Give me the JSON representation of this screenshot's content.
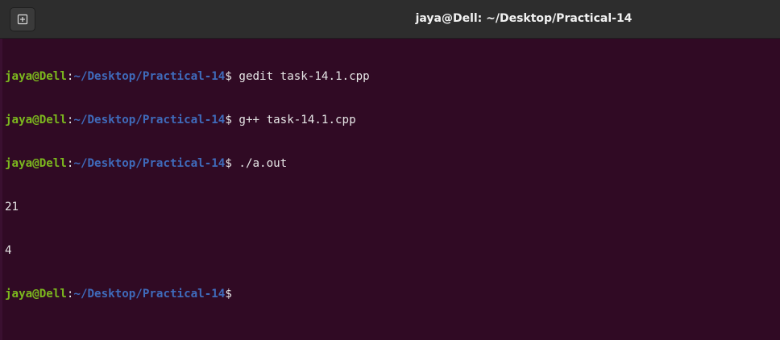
{
  "window": {
    "title": "jaya@Dell: ~/Desktop/Practical-14"
  },
  "titlebar": {
    "new_tab_icon": "new-tab-icon"
  },
  "terminal": {
    "lines": [
      {
        "type": "prompt",
        "user": "jaya@Dell",
        "sep": ":",
        "path": "~/Desktop/Practical-14",
        "dollar": "$",
        "command": " gedit task-14.1.cpp"
      },
      {
        "type": "prompt",
        "user": "jaya@Dell",
        "sep": ":",
        "path": "~/Desktop/Practical-14",
        "dollar": "$",
        "command": " g++ task-14.1.cpp"
      },
      {
        "type": "prompt",
        "user": "jaya@Dell",
        "sep": ":",
        "path": "~/Desktop/Practical-14",
        "dollar": "$",
        "command": " ./a.out"
      },
      {
        "type": "output",
        "text": "21"
      },
      {
        "type": "output",
        "text": "4"
      },
      {
        "type": "prompt",
        "user": "jaya@Dell",
        "sep": ":",
        "path": "~/Desktop/Practical-14",
        "dollar": "$",
        "command": ""
      }
    ]
  },
  "colors": {
    "background": "#300a24",
    "user": "#7cb81e",
    "path": "#3f6bbb",
    "text": "#e6e6e6",
    "titlebar": "#2d2d2d"
  }
}
